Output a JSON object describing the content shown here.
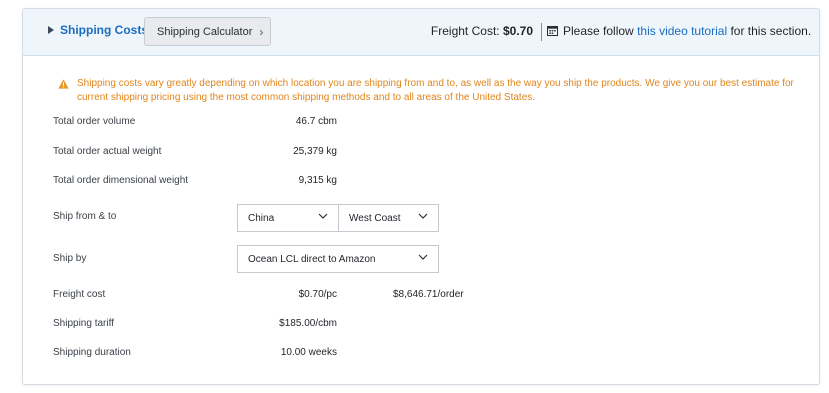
{
  "header": {
    "title": "Shipping Costs",
    "calculator_button": "Shipping Calculator",
    "freight_cost_label": "Freight Cost:",
    "freight_cost_value": "$0.70",
    "tutorial_prefix": "Please follow",
    "tutorial_link": "this video tutorial",
    "tutorial_suffix": "for this section."
  },
  "warning": {
    "text": "Shipping costs vary greatly depending on which location you are shipping from and to, as well as the way you ship the products. We give you our best estimate for current shipping pricing using the most common shipping methods and to all areas of the United States."
  },
  "summary": {
    "volume_label": "Total order volume",
    "volume_value": "46.7 cbm",
    "actual_weight_label": "Total order actual weight",
    "actual_weight_value": "25,379 kg",
    "dim_weight_label": "Total order dimensional weight",
    "dim_weight_value": "9,315 kg"
  },
  "form": {
    "ship_from_to_label": "Ship from & to",
    "ship_from_value": "China",
    "ship_to_value": "West Coast",
    "ship_by_label": "Ship by",
    "ship_by_value": "Ocean LCL direct to Amazon"
  },
  "results": {
    "freight_cost_label": "Freight cost",
    "freight_cost_per_pc": "$0.70/pc",
    "freight_cost_per_order": "$8,646.71/order",
    "tariff_label": "Shipping tariff",
    "tariff_value": "$185.00/cbm",
    "duration_label": "Shipping duration",
    "duration_value": "10.00 weeks"
  },
  "colors": {
    "accent": "#1b6bbf",
    "warning": "#e0851c",
    "header_bg": "#eef6fc"
  },
  "icons": {
    "expand": "triangle-right-icon",
    "calendar": "calendar-icon",
    "warning": "warning-triangle-icon",
    "dropdown": "chevron-down-icon"
  }
}
